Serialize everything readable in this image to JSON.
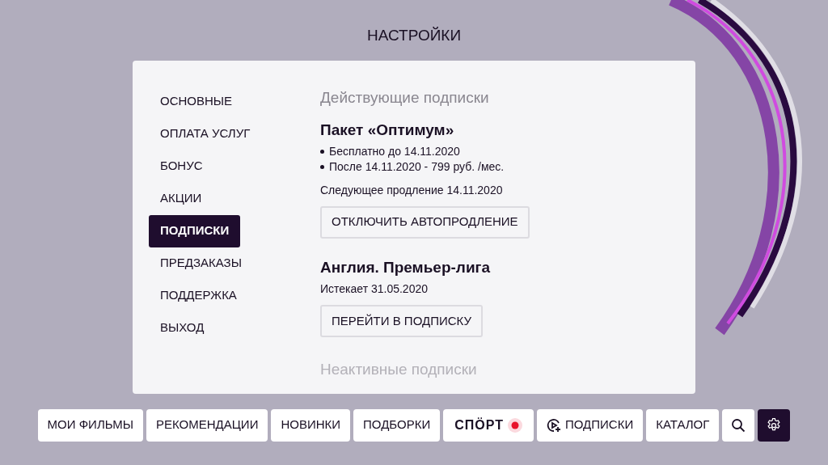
{
  "title": "НАСТРОЙКИ",
  "sidebar": {
    "items": [
      {
        "label": "ОСНОВНЫЕ",
        "selected": false
      },
      {
        "label": "ОПЛАТА УСЛУГ",
        "selected": false
      },
      {
        "label": "БОНУС",
        "selected": false
      },
      {
        "label": "АКЦИИ",
        "selected": false
      },
      {
        "label": "ПОДПИСКИ",
        "selected": true
      },
      {
        "label": "ПРЕДЗАКАЗЫ",
        "selected": false
      },
      {
        "label": "ПОДДЕРЖКА",
        "selected": false
      },
      {
        "label": "ВЫХОД",
        "selected": false
      }
    ]
  },
  "active_heading": "Действующие подписки",
  "subscriptions": [
    {
      "name": "Пакет «**Оптимум**»",
      "bullets": [
        "Бесплатно до 14.11.2020",
        "После 14.11.2020 - 799 руб. /мес."
      ],
      "note": "Следующее продление 14.11.2020",
      "button": "ОТКЛЮЧИТЬ АВТОПРОДЛЕНИЕ"
    },
    {
      "name": "Англия. Премьер-лига",
      "note": "Истекает 31.05.2020",
      "button": "ПЕРЕЙТИ В ПОДПИСКУ"
    }
  ],
  "inactive_heading": "Неактивные подписки",
  "nav": [
    {
      "kind": "text",
      "label": "МОИ ФИЛЬМЫ",
      "selected": false
    },
    {
      "kind": "text",
      "label": "РЕКОМЕНДАЦИИ",
      "selected": false
    },
    {
      "kind": "text",
      "label": "НОВИНКИ",
      "selected": false
    },
    {
      "kind": "text",
      "label": "ПОДБОРКИ",
      "selected": false
    },
    {
      "kind": "sport",
      "label": "СПÖРТ",
      "selected": false
    },
    {
      "kind": "play",
      "label": "ПОДПИСКИ",
      "selected": false
    },
    {
      "kind": "text",
      "label": "КАТАЛОГ",
      "selected": false
    },
    {
      "kind": "search",
      "selected": false
    },
    {
      "kind": "settings",
      "selected": true
    }
  ]
}
